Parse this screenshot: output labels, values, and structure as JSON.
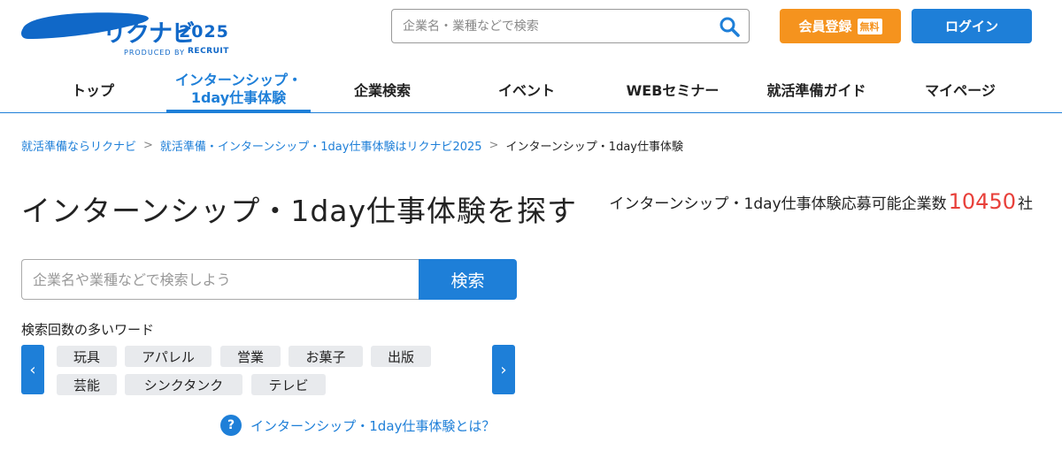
{
  "header": {
    "logo_text": "リクナビ",
    "logo_year": "2025",
    "logo_produced_by": "PRODUCED BY",
    "logo_recruit": "RECRUIT",
    "search_placeholder": "企業名・業種などで検索",
    "register_label": "会員登録",
    "register_badge": "無料",
    "login_label": "ログイン"
  },
  "nav": {
    "items": [
      {
        "label": "トップ"
      },
      {
        "label": "インターンシップ・\n1day仕事体験",
        "active": true
      },
      {
        "label": "企業検索"
      },
      {
        "label": "イベント"
      },
      {
        "label": "WEBセミナー"
      },
      {
        "label": "就活準備ガイド"
      },
      {
        "label": "マイページ"
      }
    ]
  },
  "breadcrumb": {
    "items": [
      "就活準備ならリクナビ",
      "就活準備・インターンシップ・1day仕事体験はリクナビ2025",
      "インターンシップ・1day仕事体験"
    ],
    "separator": ">"
  },
  "main": {
    "title": "インターンシップ・1day仕事体験を探す",
    "count_prefix": "インターンシップ・1day仕事体験応募可能企業数",
    "count_value": "10450",
    "count_suffix": "社",
    "search_placeholder": "企業名や業種などで検索しよう",
    "search_button": "検索",
    "popular_title": "検索回数の多いワード",
    "popular_words": [
      "玩具",
      "アパレル",
      "営業",
      "お菓子",
      "出版",
      "芸能",
      "シンクタンク",
      "テレビ"
    ],
    "arrow_left": "‹",
    "arrow_right": "›",
    "help_icon_text": "?",
    "help_text": "インターンシップ・1day仕事体験とは？"
  },
  "colors": {
    "accent": "#1e7fd8",
    "register": "#f5931e",
    "count": "#e8403a",
    "tag_bg": "#e8eaed"
  }
}
